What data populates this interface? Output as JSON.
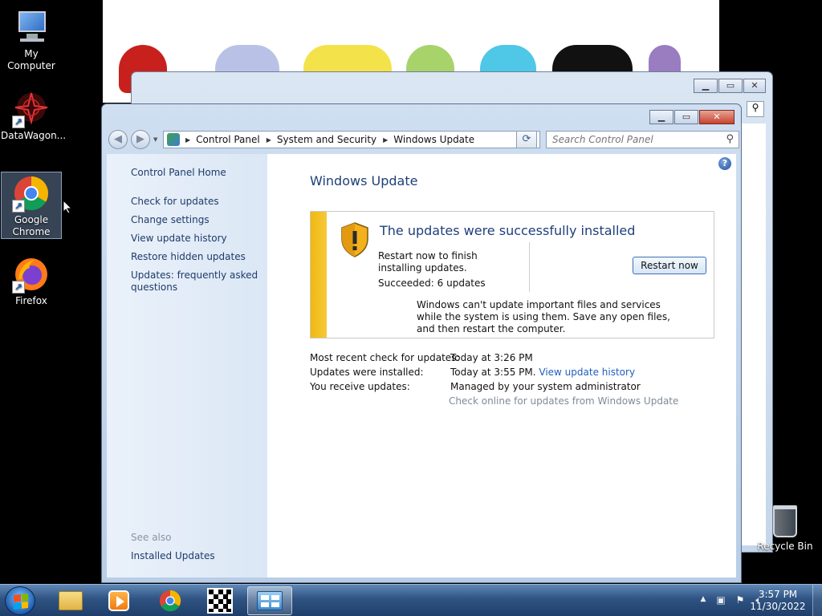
{
  "desktop": {
    "icons": [
      {
        "label": "My Computer"
      },
      {
        "label": "DataWagon..."
      },
      {
        "label": "Google Chrome"
      },
      {
        "label": "Firefox"
      },
      {
        "label": "Recycle Bin"
      }
    ]
  },
  "window": {
    "breadcrumbs": [
      "Control Panel",
      "System and Security",
      "Windows Update"
    ],
    "search_placeholder": "Search Control Panel",
    "left_pane": {
      "home": "Control Panel Home",
      "links": [
        "Check for updates",
        "Change settings",
        "View update history",
        "Restore hidden updates",
        "Updates: frequently asked questions"
      ],
      "see_also_title": "See also",
      "see_also_links": [
        "Installed Updates"
      ]
    },
    "main": {
      "title": "Windows Update",
      "status_heading": "The updates were successfully installed",
      "restart_text": "Restart now to finish installing updates.",
      "succeeded_text": "Succeeded: 6 updates",
      "restart_button": "Restart now",
      "warning_text": "Windows can't update important files and services while the system is using them. Save any open files, and then restart the computer.",
      "info": [
        {
          "label": "Most recent check for updates:",
          "value": "Today at 3:26 PM"
        },
        {
          "label": "Updates were installed:",
          "value": "Today at 3:55 PM.",
          "link": "View update history"
        },
        {
          "label": "You receive updates:",
          "value": "Managed by your system administrator"
        }
      ],
      "online_check_link": "Check online for updates from Windows Update"
    }
  },
  "taskbar": {
    "time": "3:57 PM",
    "date": "11/30/2022"
  },
  "colors": {
    "status_stripe": "#f1b80f",
    "title_blue": "#1e3f7a",
    "link_blue": "#1f5fbf"
  }
}
